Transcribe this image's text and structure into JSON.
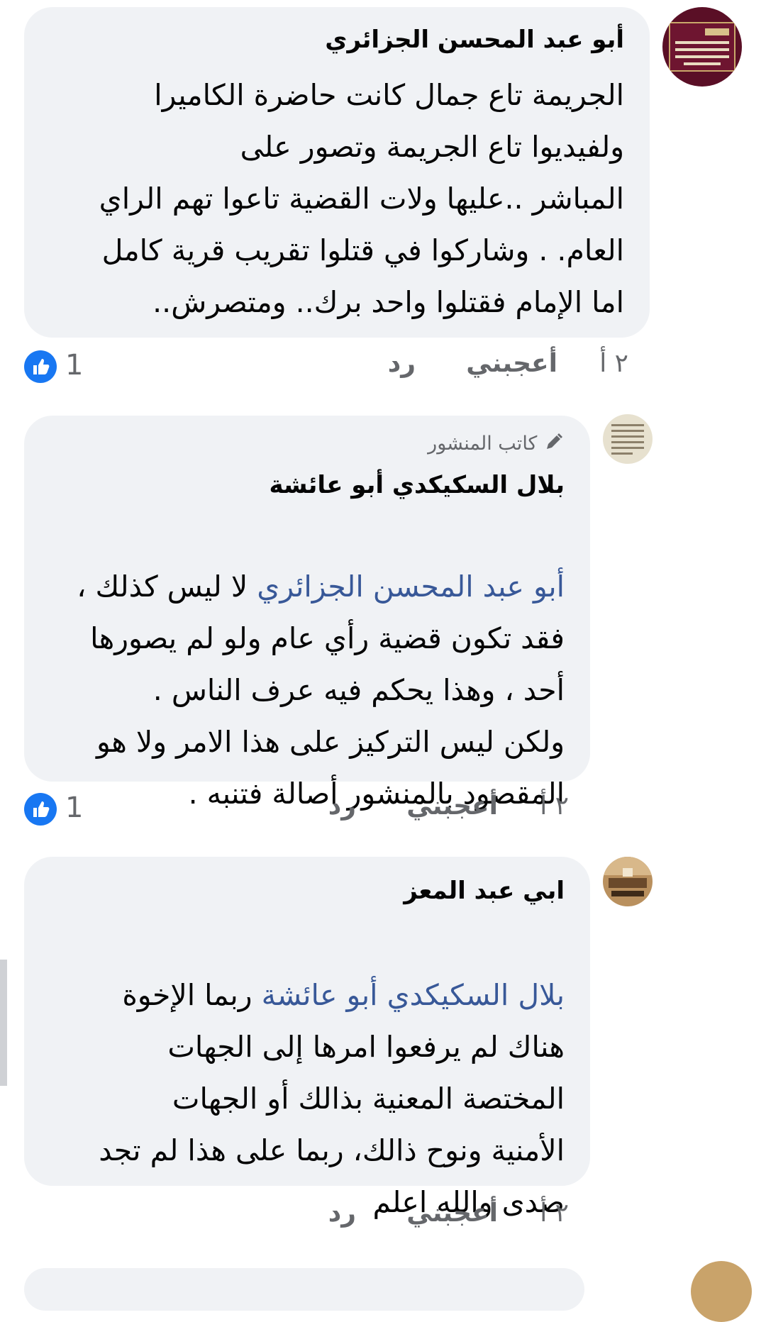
{
  "comments": [
    {
      "author": "أبو عبد المحسن الجزائري",
      "text": "الجريمة تاع جمال كانت حاضرة الكاميرا\nولفيديوا تاع الجريمة وتصور على\nالمباشر ..عليها ولات القضية تاعوا تهم الراي\nالعام. .  وشاركوا في قتلوا تقريب قرية كامل\nاما الإمام فقتلوا واحد برك.. ومتصرش..",
      "time": "٢ أ",
      "like_label": "أعجبني",
      "reply_label": "رد",
      "reaction_count": "1"
    },
    {
      "badge": "كاتب المنشور",
      "author": "بلال السكيكدي أبو عائشة",
      "mention": "أبو عبد المحسن الجزائري",
      "text_after_mention": " لا ليس كذلك ،",
      "text": "فقد تكون قضية رأي عام ولو لم يصورها\nأحد ، وهذا يحكم فيه عرف الناس .\nولكن ليس التركيز على هذا الامر ولا هو\nالمقصود بالمنشور أصالة فتنبه .",
      "time": "٢ أ",
      "like_label": "أعجبني",
      "reply_label": "رد",
      "reaction_count": "1"
    },
    {
      "author": "ابي عبد المعز",
      "mention": "بلال السكيكدي أبو عائشة",
      "text_after_mention": " ربما الإخوة",
      "text": "هناك لم يرفعوا  امرها إلى الجهات\nالمختصة المعنية بذالك  أو الجهات\nالأمنية ونوح ذالك، ربما على هذا لم تجد\nصدى والله اعلم",
      "time": "٢ أ",
      "like_label": "أعجبني",
      "reply_label": "رد"
    }
  ],
  "icons": {
    "like_reaction": "thumbs-up-icon",
    "author_badge": "pencil-icon"
  },
  "colors": {
    "bubble": "#f0f2f5",
    "mention": "#385898",
    "like_reaction": "#1877f2",
    "meta": "#65676b"
  }
}
